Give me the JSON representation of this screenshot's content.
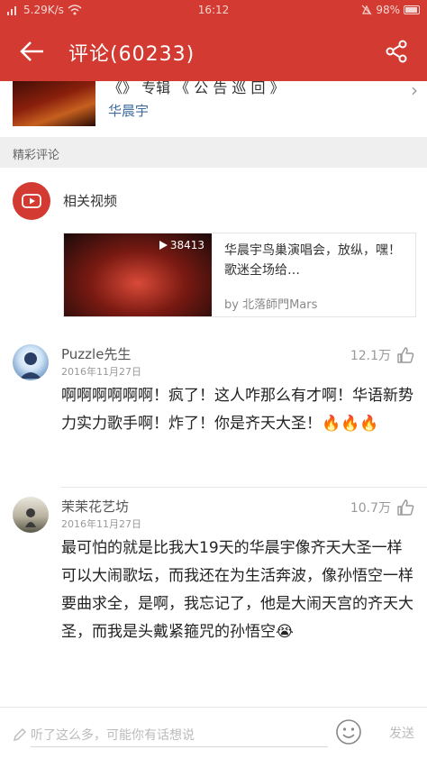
{
  "status_bar": {
    "network_speed": "5.29K/s",
    "time": "16:12",
    "battery": "98%"
  },
  "app_bar": {
    "title": "评论(60233)"
  },
  "song": {
    "title": "《》 专辑 《 公 告 巡 回 》",
    "artist": "华晨宇"
  },
  "section": {
    "header": "精彩评论"
  },
  "related_video": {
    "label": "相关视频",
    "play_count": "38413",
    "title": "华晨宇鸟巢演唱会，放纵，嘿！歌迷全场给…",
    "by": "by 北落師門Mars"
  },
  "comments": [
    {
      "username": "Puzzle先生",
      "date": "2016年11月27日",
      "likes": "12.1万",
      "text": "啊啊啊啊啊啊！疯了！这人咋那么有才啊！华语新势力实力歌手啊！炸了！你是齐天大圣！🔥🔥🔥"
    },
    {
      "username": "茉茉花艺坊",
      "date": "2016年11月27日",
      "likes": "10.7万",
      "text": "最可怕的就是比我大19天的华晨宇像齐天大圣一样可以大闹歌坛，而我还在为生活奔波，像孙悟空一样要曲求全，是啊，我忘记了，他是大闹天宫的齐天大圣，而我是头戴紧箍咒的孙悟空😭"
    }
  ],
  "input_bar": {
    "placeholder": "听了这么多，可能你有话想说",
    "send_label": "发送"
  },
  "colors": {
    "brand": "#d33a31",
    "link": "#3f6b9d"
  }
}
